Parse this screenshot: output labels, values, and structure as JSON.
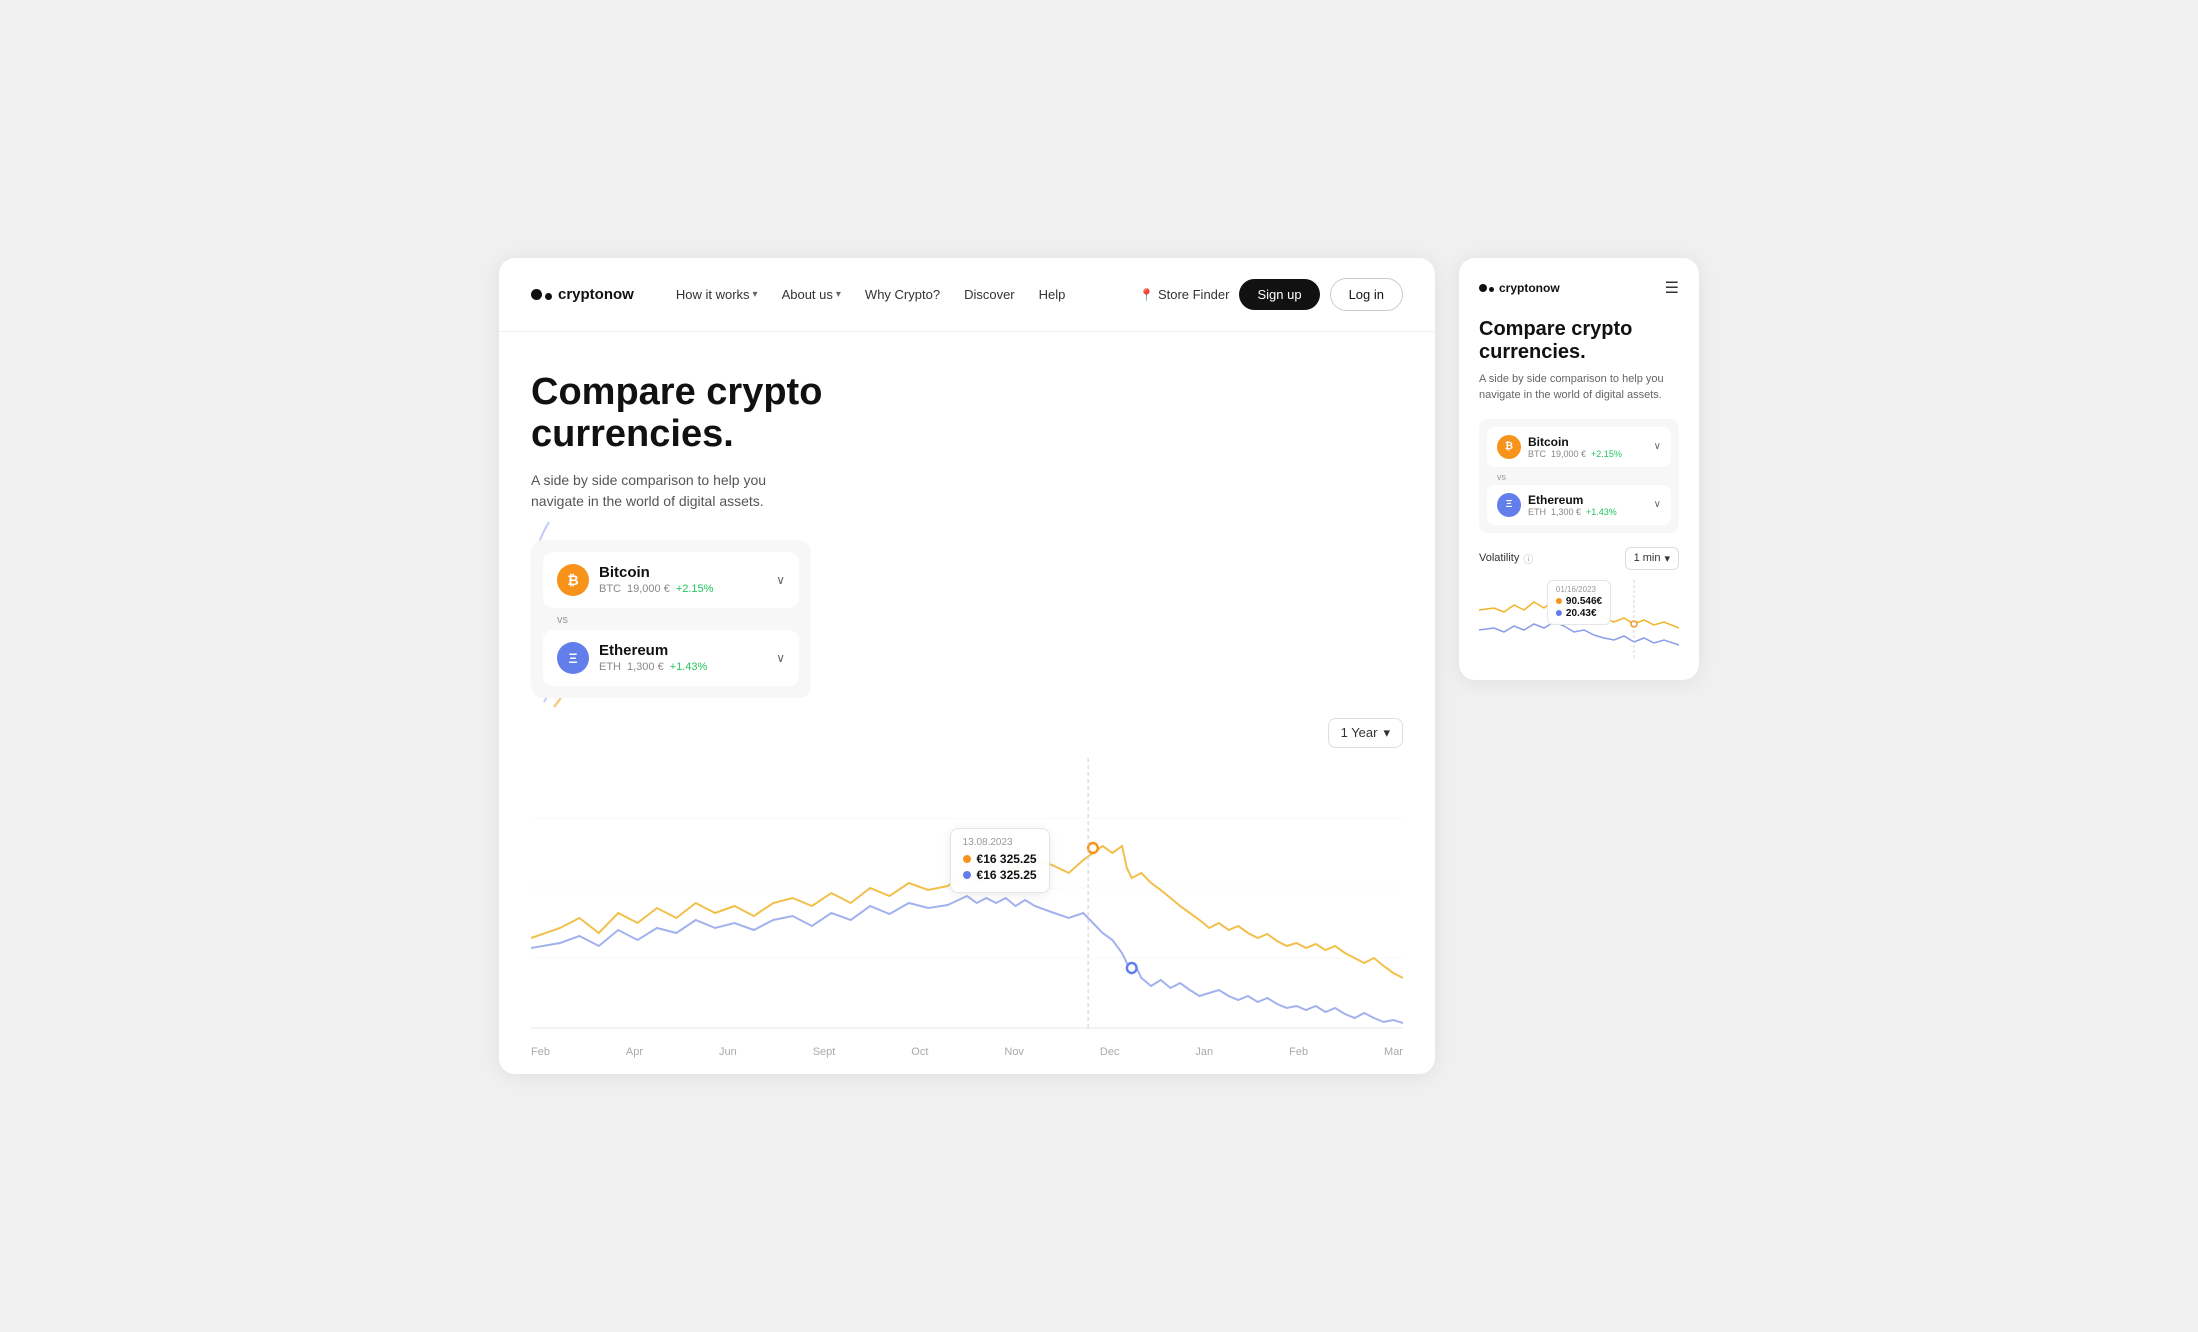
{
  "brand": {
    "name": "cryptonow"
  },
  "nav": {
    "links": [
      {
        "label": "How it works",
        "hasDropdown": true
      },
      {
        "label": "About us",
        "hasDropdown": true
      },
      {
        "label": "Why Crypto?",
        "hasDropdown": false
      },
      {
        "label": "Discover",
        "hasDropdown": false
      },
      {
        "label": "Help",
        "hasDropdown": false
      }
    ],
    "storeFinder": "Store Finder",
    "signup": "Sign up",
    "login": "Log in"
  },
  "hero": {
    "title": "Compare crypto currencies.",
    "subtitle": "A side by side comparison to help you navigate in the world of digital assets."
  },
  "timeSelector": {
    "label": "1 Year"
  },
  "coins": [
    {
      "name": "Bitcoin",
      "ticker": "BTC",
      "price": "19,000 €",
      "change": "+2.15%",
      "symbol": "₿"
    },
    {
      "name": "Ethereum",
      "ticker": "ETH",
      "price": "1,300 €",
      "change": "+1.43%",
      "symbol": "Ξ"
    }
  ],
  "vsLabel": "vs",
  "tooltip": {
    "date": "13.08.2023",
    "btcValue": "€16 325.25",
    "ethValue": "€16 325.25"
  },
  "xLabels": [
    "Feb",
    "Apr",
    "Jun",
    "Sept",
    "Oct",
    "Nov",
    "Dec",
    "Jan",
    "Feb",
    "Mar"
  ],
  "mobile": {
    "title": "Compare crypto currencies.",
    "subtitle": "A side by side comparison to help you navigate in the world of digital assets.",
    "volatility": {
      "label": "Volatility",
      "timeLabel": "1 min"
    },
    "mobileTooltip": {
      "date": "01/16/2023",
      "btcValue": "90.546€",
      "ethValue": "20.43€"
    }
  },
  "colors": {
    "btc": "#f7931a",
    "eth": "#627eea",
    "btcLine": "#f0b429",
    "ethLine": "#8b9de8",
    "accent": "#111111",
    "green": "#22c55e"
  }
}
